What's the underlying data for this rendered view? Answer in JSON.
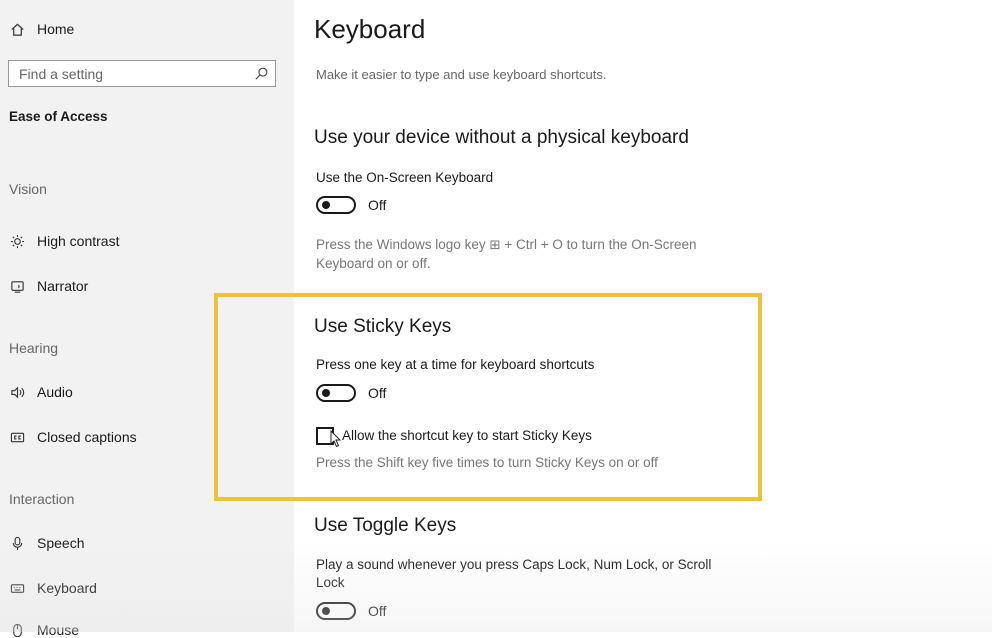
{
  "sidebar": {
    "home_label": "Home",
    "search_placeholder": "Find a setting",
    "active_category": "Ease of Access",
    "sections": {
      "vision": "Vision",
      "hearing": "Hearing",
      "interaction": "Interaction"
    },
    "items": {
      "high_contrast": "High contrast",
      "narrator": "Narrator",
      "audio": "Audio",
      "closed_captions": "Closed captions",
      "speech": "Speech",
      "keyboard": "Keyboard",
      "mouse": "Mouse"
    }
  },
  "main": {
    "title": "Keyboard",
    "description": "Make it easier to type and use keyboard shortcuts.",
    "on_screen": {
      "heading": "Use your device without a physical keyboard",
      "setting_label": "Use the On-Screen Keyboard",
      "state": "Off",
      "help_line1": "Press the Windows logo key ⊞ + Ctrl + O to turn the On-Screen",
      "help_line2": "Keyboard on or off."
    },
    "sticky_keys": {
      "heading": "Use Sticky Keys",
      "setting_label": "Press one key at a time for keyboard shortcuts",
      "state": "Off",
      "checkbox_label": "Allow the shortcut key to start Sticky Keys",
      "help": "Press the Shift key five times to turn Sticky Keys on or off"
    },
    "toggle_keys": {
      "heading": "Use Toggle Keys",
      "setting_label_line1": "Play a sound whenever you press Caps Lock, Num Lock, or Scroll",
      "setting_label_line2": "Lock",
      "state": "Off"
    }
  },
  "colors": {
    "highlight": "#f0c23a",
    "sidebar_bg": "#f2f2f2"
  }
}
